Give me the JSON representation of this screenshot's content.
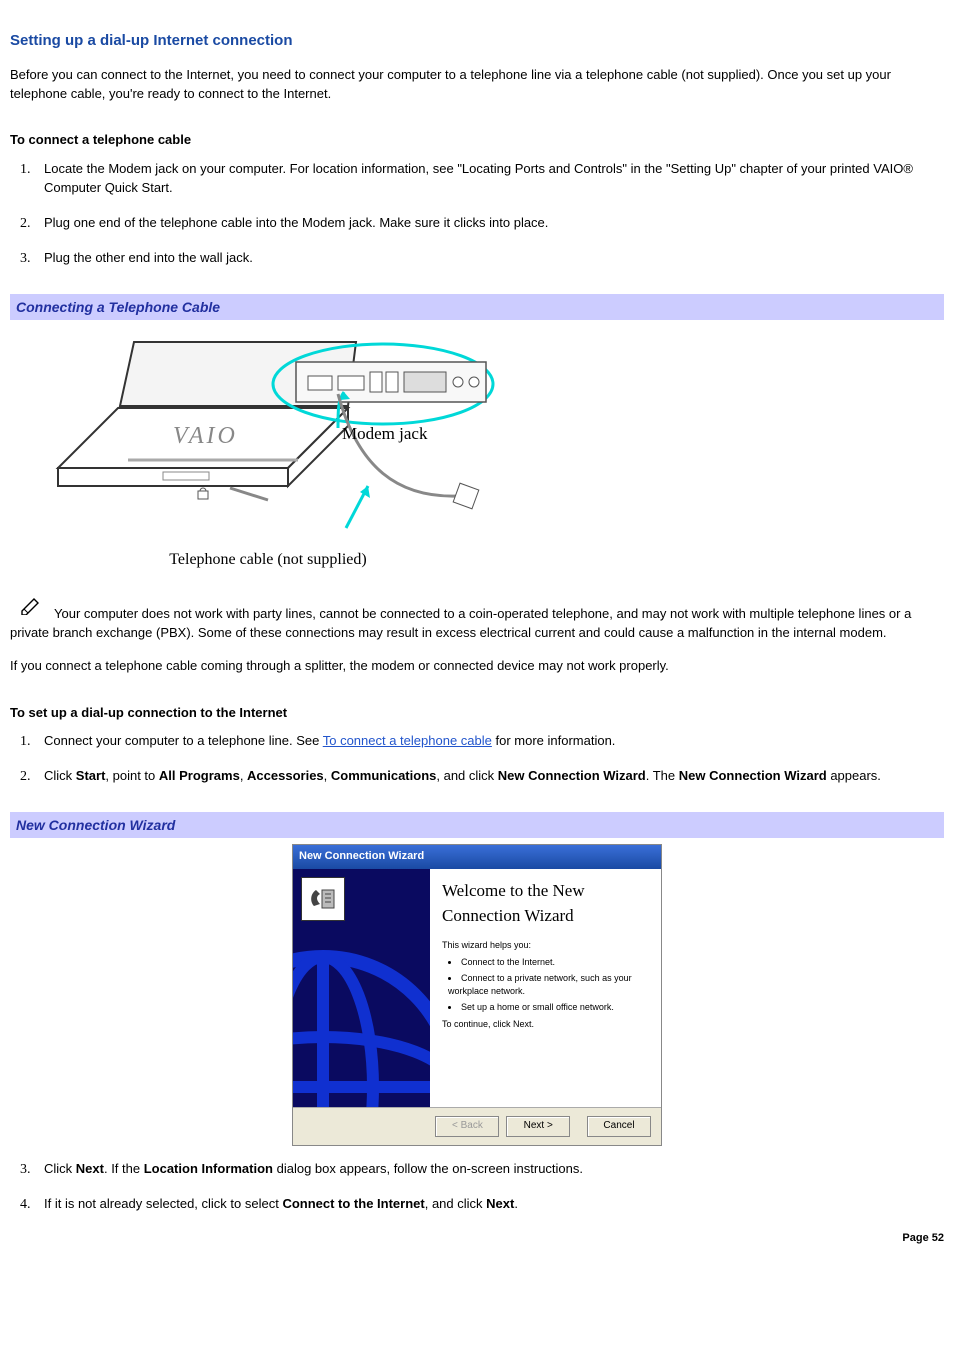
{
  "heading": "Setting up a dial-up Internet connection",
  "intro": "Before you can connect to the Internet, you need to connect your computer to a telephone line via a telephone cable (not supplied). Once you set up your telephone cable, you're ready to connect to the Internet.",
  "sub1": {
    "title": "To connect a telephone cable",
    "items": [
      "Locate the Modem jack on your computer. For location information, see \"Locating Ports and Controls\" in the \"Setting Up\" chapter of your printed VAIO® Computer Quick Start.",
      "Plug one end of the telephone cable into the Modem jack. Make sure it clicks into place.",
      "Plug the other end into the wall jack."
    ]
  },
  "bar1": "Connecting a Telephone Cable",
  "diagram": {
    "label_modem": "Modem jack",
    "caption": "Telephone cable (not supplied)"
  },
  "note1": "Your computer does not work with party lines, cannot be connected to a coin-operated telephone, and may not work with multiple telephone lines or a private branch exchange (PBX). Some of these connections may result in excess electrical current and could cause a malfunction in the internal modem.",
  "note2": "If you connect a telephone cable coming through a splitter, the modem or connected device may not work properly.",
  "sub2": {
    "title": "To set up a dial-up connection to the Internet",
    "item1_pre": "Connect your computer to a telephone line. See ",
    "item1_link": "To connect a telephone cable",
    "item1_post": " for more information.",
    "item2": {
      "pre": "Click ",
      "b1": "Start",
      "t1": ", point to ",
      "b2": "All Programs",
      "t2": ", ",
      "b3": "Accessories",
      "t3": ", ",
      "b4": "Communications",
      "t4": ", and click ",
      "b5": "New Connection Wizard",
      "t5": ". The ",
      "b6": "New Connection Wizard",
      "t6": " appears."
    },
    "item3": {
      "pre": "Click ",
      "b1": "Next",
      "t1": ". If the ",
      "b2": "Location Information",
      "t2": " dialog box appears, follow the on-screen instructions."
    },
    "item4": {
      "pre": "If it is not already selected, click to select ",
      "b1": "Connect to the Internet",
      "t1": ", and click ",
      "b2": "Next",
      "t2": "."
    }
  },
  "bar2": "New Connection Wizard",
  "wizard": {
    "title": "New Connection Wizard",
    "welcome": "Welcome to the New Connection Wizard",
    "helps": "This wizard helps you:",
    "bullets": [
      "Connect to the Internet.",
      "Connect to a private network, such as your workplace network.",
      "Set up a home or small office network."
    ],
    "cont": "To continue, click Next.",
    "back": "< Back",
    "next": "Next >",
    "cancel": "Cancel"
  },
  "page": "Page 52"
}
